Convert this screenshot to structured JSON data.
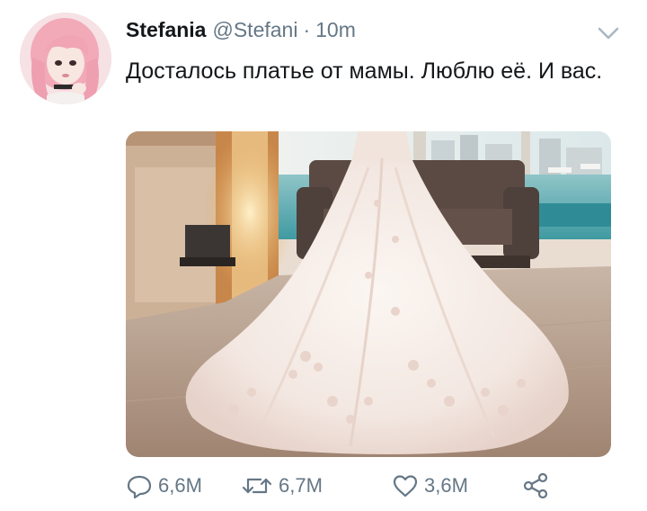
{
  "tweet": {
    "display_name": "Stefania",
    "handle": "@Stefani",
    "separator": "·",
    "time": "10m",
    "text": "Досталось платье от мамы. Люблю её. И вас.",
    "avatar_icon": "profile-avatar",
    "media_icon": "wedding-dress-photo",
    "menu_icon": "chevron-down-icon"
  },
  "actions": {
    "reply_count": "6,6M",
    "retweet_count": "6,7M",
    "like_count": "3,6M",
    "reply_icon": "reply-icon",
    "retweet_icon": "retweet-icon",
    "like_icon": "heart-icon",
    "share_icon": "share-icon"
  },
  "colors": {
    "text": "#14171a",
    "secondary": "#657786",
    "background": "#ffffff"
  }
}
